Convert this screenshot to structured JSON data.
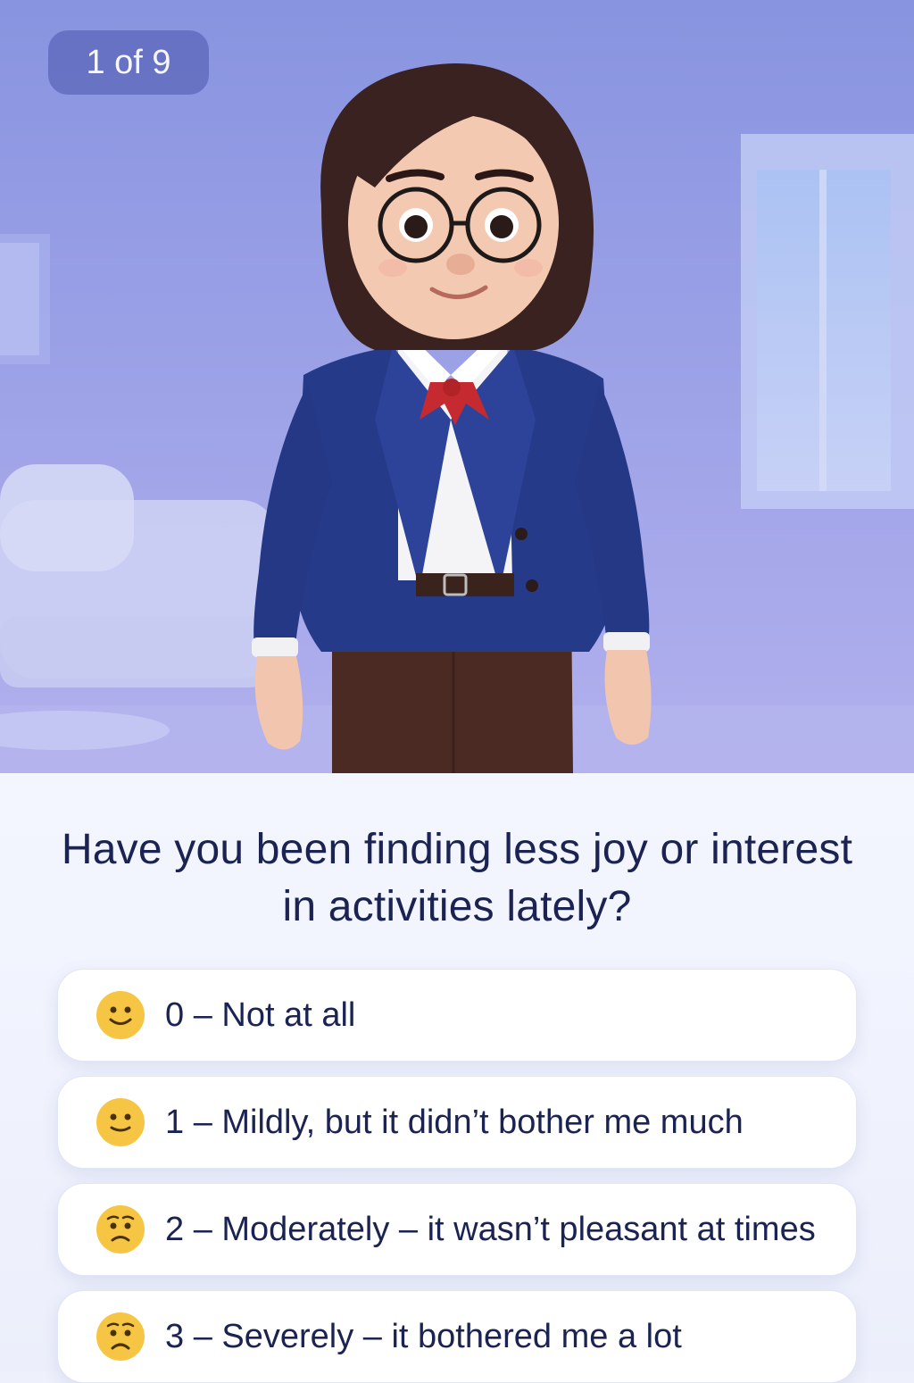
{
  "progress": {
    "text": "1 of 9",
    "current": 1,
    "total": 9
  },
  "question": {
    "text": "Have you been finding less joy or interest in activities lately?"
  },
  "options": [
    {
      "label": "0 – Not at all",
      "emoji": "slight-smile-emoji"
    },
    {
      "label": "1 – Mildly, but it didn’t bother me much",
      "emoji": "slight-smile-emoji"
    },
    {
      "label": "2 – Moderately – it wasn’t pleasant at times",
      "emoji": "worried-face-emoji"
    },
    {
      "label": "3 – Severely – it bothered me a lot",
      "emoji": "worried-face-emoji"
    }
  ],
  "colors": {
    "accent": "#6670c2",
    "hero_background": "#a3a9ea",
    "text_primary": "#1b2352",
    "emoji_yellow": "#f6c544"
  }
}
